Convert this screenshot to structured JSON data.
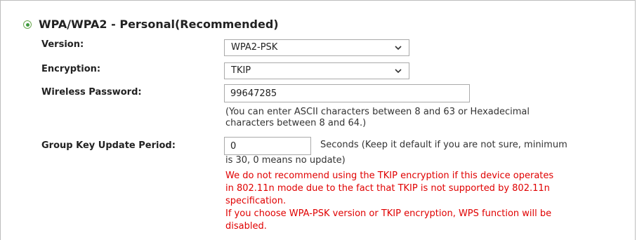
{
  "section": {
    "title": "WPA/WPA2 - Personal(Recommended)",
    "selected": true
  },
  "fields": {
    "version": {
      "label": "Version:",
      "value": "WPA2-PSK"
    },
    "encryption": {
      "label": "Encryption:",
      "value": "TKIP"
    },
    "password": {
      "label": "Wireless Password:",
      "value": "99647285",
      "hint_line1": "(You can enter ASCII characters between 8 and 63 or Hexadecimal",
      "hint_line2": "characters between 8 and 64.)"
    },
    "group_key": {
      "label": "Group Key Update Period:",
      "value": "0",
      "hint_line1": "Seconds (Keep it default if you are not sure, minimum",
      "hint_line2": "is 30, 0 means no update)"
    }
  },
  "warnings": {
    "tkip_line1": "We do not recommend using the TKIP encryption if this device operates",
    "tkip_line2": "in 802.11n mode due to the fact that TKIP is not supported by 802.11n",
    "tkip_line3": "specification.",
    "wps_line1": "If you choose WPA-PSK version or TKIP encryption, WPS function will be",
    "wps_line2": "disabled."
  },
  "colors": {
    "warning_text": "#e00000",
    "radio_accent": "#3f9a3f",
    "border": "#aaaaaa"
  }
}
